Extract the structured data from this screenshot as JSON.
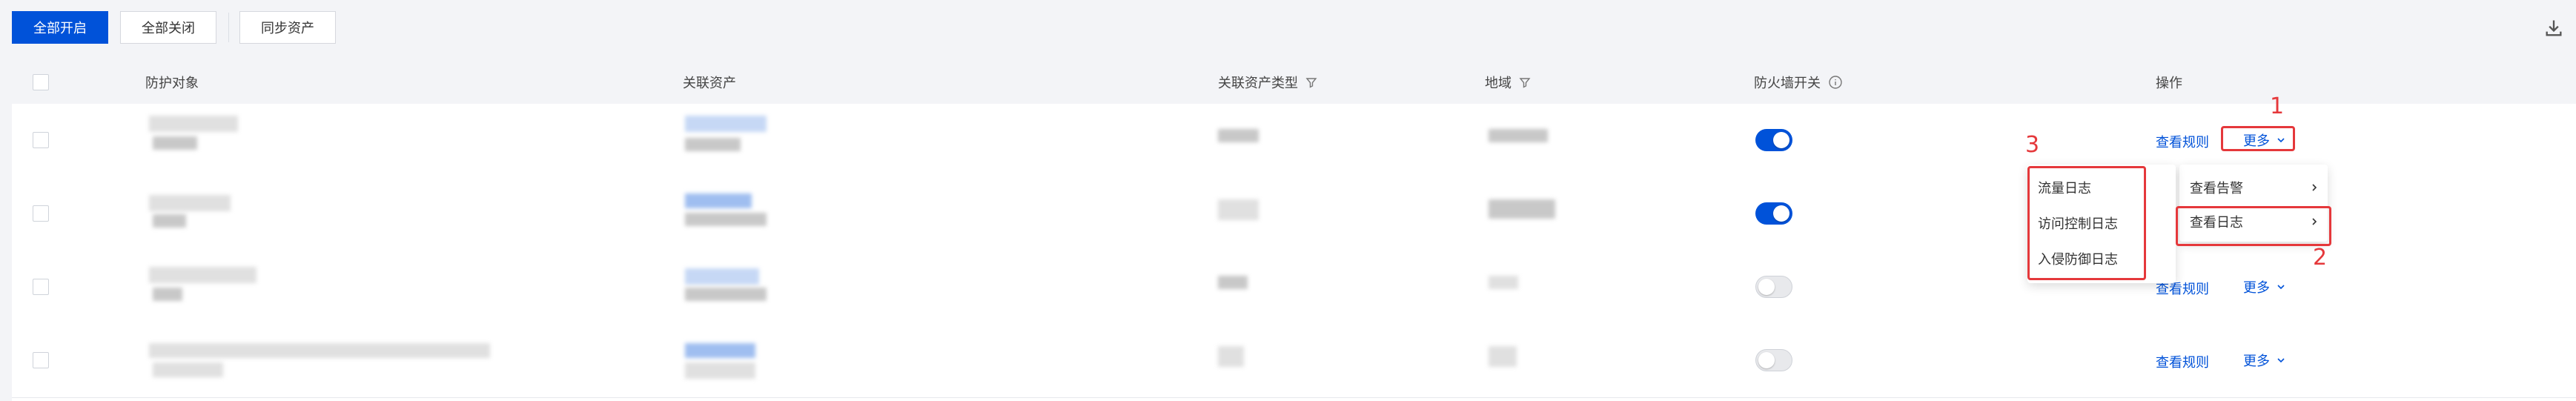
{
  "toolbar": {
    "enable_all": "全部开启",
    "disable_all": "全部关闭",
    "sync_assets": "同步资产"
  },
  "table": {
    "columns": {
      "protected_object": "防护对象",
      "related_asset": "关联资产",
      "asset_type": "关联资产类型",
      "region": "地域",
      "firewall_switch": "防火墙开关",
      "actions": "操作"
    },
    "rows": [
      {
        "firewall_on": true,
        "action_rules": "查看规则",
        "action_more": "更多"
      },
      {
        "firewall_on": true,
        "action_rules": "查看规则",
        "action_more": "更多"
      },
      {
        "firewall_on": false,
        "action_rules": "查看规则",
        "action_more": "更多"
      },
      {
        "firewall_on": false,
        "action_rules": "查看规则",
        "action_more": "更多"
      }
    ]
  },
  "more_menu": {
    "items": [
      "查看告警",
      "查看日志"
    ]
  },
  "log_submenu": {
    "items": [
      "流量日志",
      "访问控制日志",
      "入侵防御日志"
    ]
  },
  "annotations": [
    "1",
    "2",
    "3"
  ],
  "colors": {
    "primary": "#0052d9",
    "annotation": "#e5383b"
  },
  "icons": [
    "download-icon",
    "filter-icon",
    "info-icon",
    "chevron-down-icon",
    "chevron-right-icon"
  ]
}
